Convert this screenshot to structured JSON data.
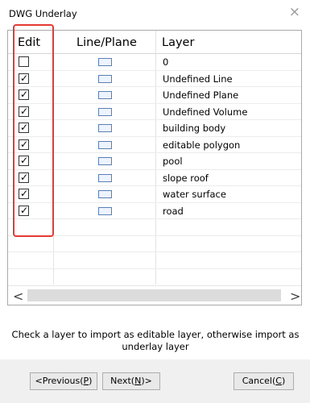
{
  "window": {
    "title": "DWG Underlay",
    "close_glyph": "×"
  },
  "table": {
    "columns": [
      "Edit",
      "Line/Plane",
      "Layer"
    ],
    "rows": [
      {
        "edit": false,
        "layer": "0"
      },
      {
        "edit": true,
        "layer": "Undefined Line"
      },
      {
        "edit": true,
        "layer": "Undefined Plane"
      },
      {
        "edit": true,
        "layer": "Undefined Volume"
      },
      {
        "edit": true,
        "layer": "building body"
      },
      {
        "edit": true,
        "layer": "editable polygon"
      },
      {
        "edit": true,
        "layer": "pool"
      },
      {
        "edit": true,
        "layer": "slope roof"
      },
      {
        "edit": true,
        "layer": "water surface"
      },
      {
        "edit": true,
        "layer": "road"
      }
    ],
    "scroll_left_glyph": "<",
    "scroll_right_glyph": ">"
  },
  "hint": "Check a layer to import as editable layer, otherwise import as underlay layer",
  "buttons": {
    "previous": {
      "text": "<Previous(",
      "key": "P",
      "suffix": ")"
    },
    "next": {
      "text": "Next(",
      "key": "N",
      "suffix": ")>"
    },
    "cancel": {
      "text": "Cancel(",
      "key": "C",
      "suffix": ")"
    }
  },
  "colors": {
    "highlight_box": "#e53935",
    "plane_icon": "#5a7fb5"
  }
}
